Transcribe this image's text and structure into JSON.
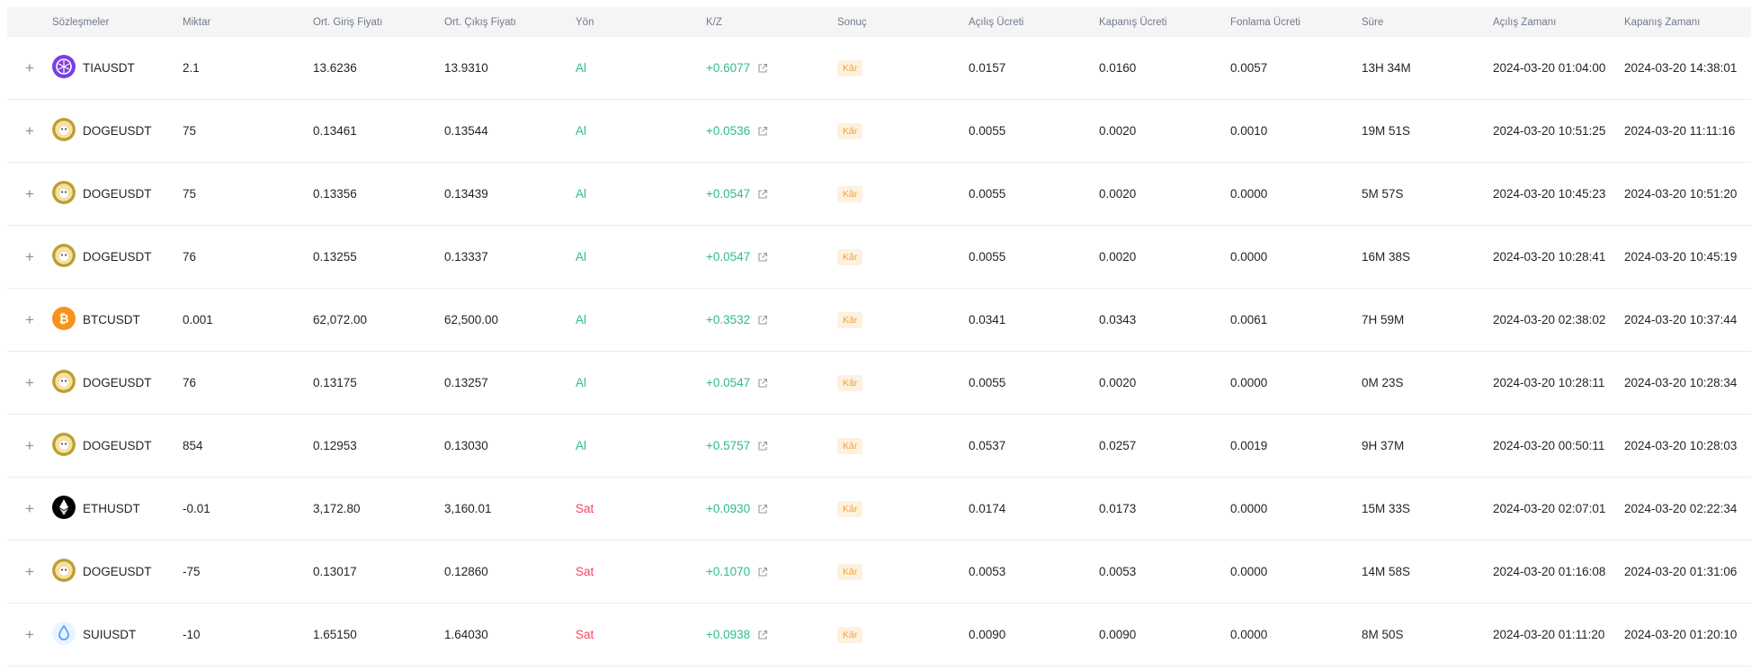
{
  "columns": {
    "contract": "Sözleşmeler",
    "quantity": "Miktar",
    "avg_entry": "Ort. Giriş Fiyatı",
    "avg_exit": "Ort. Çıkış Fiyatı",
    "side": "Yön",
    "pnl": "K/Z",
    "result": "Sonuç",
    "open_fee": "Açılış Ücreti",
    "close_fee": "Kapanış Ücreti",
    "funding_fee": "Fonlama Ücreti",
    "duration": "Süre",
    "open_time": "Açılış Zamanı",
    "close_time": "Kapanış Zamanı"
  },
  "expand_symbol": "+",
  "colors": {
    "buy": "#2ebd85",
    "sell": "#f6465d",
    "badge_bg": "#fdf1df",
    "badge_text": "#f0a33a",
    "header_bg": "#f5f5f5"
  },
  "rows": [
    {
      "coin_icon": "tia-icon",
      "contract": "TIAUSDT",
      "quantity": "2.1",
      "avg_entry": "13.6236",
      "avg_exit": "13.9310",
      "side": "Al",
      "side_type": "buy",
      "pnl": "+0.6077",
      "result": "Kâr",
      "open_fee": "0.0157",
      "close_fee": "0.0160",
      "funding_fee": "0.0057",
      "duration": "13H 34M",
      "open_time": "2024-03-20 01:04:00",
      "close_time": "2024-03-20 14:38:01"
    },
    {
      "coin_icon": "doge-icon",
      "contract": "DOGEUSDT",
      "quantity": "75",
      "avg_entry": "0.13461",
      "avg_exit": "0.13544",
      "side": "Al",
      "side_type": "buy",
      "pnl": "+0.0536",
      "result": "Kâr",
      "open_fee": "0.0055",
      "close_fee": "0.0020",
      "funding_fee": "0.0010",
      "duration": "19M 51S",
      "open_time": "2024-03-20 10:51:25",
      "close_time": "2024-03-20 11:11:16"
    },
    {
      "coin_icon": "doge-icon",
      "contract": "DOGEUSDT",
      "quantity": "75",
      "avg_entry": "0.13356",
      "avg_exit": "0.13439",
      "side": "Al",
      "side_type": "buy",
      "pnl": "+0.0547",
      "result": "Kâr",
      "open_fee": "0.0055",
      "close_fee": "0.0020",
      "funding_fee": "0.0000",
      "duration": "5M 57S",
      "open_time": "2024-03-20 10:45:23",
      "close_time": "2024-03-20 10:51:20"
    },
    {
      "coin_icon": "doge-icon",
      "contract": "DOGEUSDT",
      "quantity": "76",
      "avg_entry": "0.13255",
      "avg_exit": "0.13337",
      "side": "Al",
      "side_type": "buy",
      "pnl": "+0.0547",
      "result": "Kâr",
      "open_fee": "0.0055",
      "close_fee": "0.0020",
      "funding_fee": "0.0000",
      "duration": "16M 38S",
      "open_time": "2024-03-20 10:28:41",
      "close_time": "2024-03-20 10:45:19"
    },
    {
      "coin_icon": "btc-icon",
      "contract": "BTCUSDT",
      "quantity": "0.001",
      "avg_entry": "62,072.00",
      "avg_exit": "62,500.00",
      "side": "Al",
      "side_type": "buy",
      "pnl": "+0.3532",
      "result": "Kâr",
      "open_fee": "0.0341",
      "close_fee": "0.0343",
      "funding_fee": "0.0061",
      "duration": "7H 59M",
      "open_time": "2024-03-20 02:38:02",
      "close_time": "2024-03-20 10:37:44"
    },
    {
      "coin_icon": "doge-icon",
      "contract": "DOGEUSDT",
      "quantity": "76",
      "avg_entry": "0.13175",
      "avg_exit": "0.13257",
      "side": "Al",
      "side_type": "buy",
      "pnl": "+0.0547",
      "result": "Kâr",
      "open_fee": "0.0055",
      "close_fee": "0.0020",
      "funding_fee": "0.0000",
      "duration": "0M 23S",
      "open_time": "2024-03-20 10:28:11",
      "close_time": "2024-03-20 10:28:34"
    },
    {
      "coin_icon": "doge-icon",
      "contract": "DOGEUSDT",
      "quantity": "854",
      "avg_entry": "0.12953",
      "avg_exit": "0.13030",
      "side": "Al",
      "side_type": "buy",
      "pnl": "+0.5757",
      "result": "Kâr",
      "open_fee": "0.0537",
      "close_fee": "0.0257",
      "funding_fee": "0.0019",
      "duration": "9H 37M",
      "open_time": "2024-03-20 00:50:11",
      "close_time": "2024-03-20 10:28:03"
    },
    {
      "coin_icon": "eth-icon",
      "contract": "ETHUSDT",
      "quantity": "-0.01",
      "avg_entry": "3,172.80",
      "avg_exit": "3,160.01",
      "side": "Sat",
      "side_type": "sell",
      "pnl": "+0.0930",
      "result": "Kâr",
      "open_fee": "0.0174",
      "close_fee": "0.0173",
      "funding_fee": "0.0000",
      "duration": "15M 33S",
      "open_time": "2024-03-20 02:07:01",
      "close_time": "2024-03-20 02:22:34"
    },
    {
      "coin_icon": "doge-icon",
      "contract": "DOGEUSDT",
      "quantity": "-75",
      "avg_entry": "0.13017",
      "avg_exit": "0.12860",
      "side": "Sat",
      "side_type": "sell",
      "pnl": "+0.1070",
      "result": "Kâr",
      "open_fee": "0.0053",
      "close_fee": "0.0053",
      "funding_fee": "0.0000",
      "duration": "14M 58S",
      "open_time": "2024-03-20 01:16:08",
      "close_time": "2024-03-20 01:31:06"
    },
    {
      "coin_icon": "sui-icon",
      "contract": "SUIUSDT",
      "quantity": "-10",
      "avg_entry": "1.65150",
      "avg_exit": "1.64030",
      "side": "Sat",
      "side_type": "sell",
      "pnl": "+0.0938",
      "result": "Kâr",
      "open_fee": "0.0090",
      "close_fee": "0.0090",
      "funding_fee": "0.0000",
      "duration": "8M 50S",
      "open_time": "2024-03-20 01:11:20",
      "close_time": "2024-03-20 01:20:10"
    }
  ]
}
